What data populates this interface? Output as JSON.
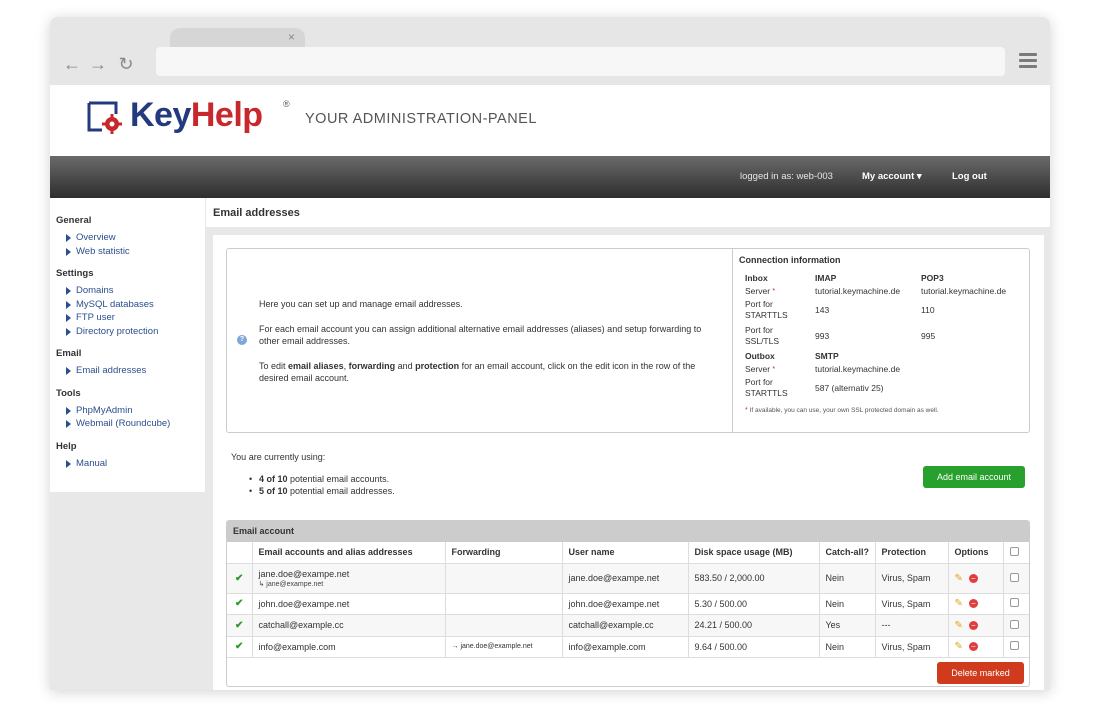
{
  "browser": {
    "tab_close": "×",
    "back_icon": "←",
    "forward_icon": "→",
    "reload_icon": "↻"
  },
  "header": {
    "logo_key": "Key",
    "logo_help": "Help",
    "logo_reg": "®",
    "tagline": "YOUR ADMINISTRATION-PANEL"
  },
  "topbar": {
    "logged_in": "logged in as: web-003",
    "my_account": "My account ▾",
    "logout": "Log out"
  },
  "sidebar": {
    "groups": [
      {
        "title": "General",
        "items": [
          "Overview",
          "Web statistic"
        ]
      },
      {
        "title": "Settings",
        "items": [
          "Domains",
          "MySQL databases",
          "FTP user",
          "Directory protection"
        ]
      },
      {
        "title": "Email",
        "items": [
          "Email addresses"
        ]
      },
      {
        "title": "Tools",
        "items": [
          "PhpMyAdmin",
          "Webmail (Roundcube)"
        ]
      },
      {
        "title": "Help",
        "items": [
          "Manual"
        ]
      }
    ]
  },
  "page": {
    "title": "Email addresses"
  },
  "info": {
    "p1": "Here you can set up and manage email addresses.",
    "p2": "For each email account you can assign additional alternative email addresses (aliases) and setup forwarding to other email addresses.",
    "p3_prefix": "To edit ",
    "p3_b1": "email aliases",
    "p3_sep1": ", ",
    "p3_b2": "forwarding",
    "p3_sep2": " and ",
    "p3_b3": "protection",
    "p3_suffix": " for an email account, click on the edit icon in the row of the desired email account."
  },
  "connection": {
    "title": "Connection information",
    "inbox": "Inbox",
    "imap": "IMAP",
    "pop3": "POP3",
    "server": "Server",
    "imap_server": "tutorial.keymachine.de",
    "pop3_server": "tutorial.keymachine.de",
    "port_starttls": "Port for STARTTLS",
    "imap_starttls": "143",
    "pop3_starttls": "110",
    "port_ssl": "Port for SSL/TLS",
    "imap_ssl": "993",
    "pop3_ssl": "995",
    "outbox": "Outbox",
    "smtp": "SMTP",
    "smtp_server": "tutorial.keymachine.de",
    "smtp_starttls": "587 (alternativ 25)",
    "asterisk": "*",
    "note": "If available, you can use, your own SSL protected domain as well."
  },
  "usage": {
    "intro": "You are currently using:",
    "accounts_bold": "4 of 10",
    "accounts_text": " potential email accounts.",
    "addresses_bold": "5 of 10",
    "addresses_text": " potential email addresses."
  },
  "add_button": "Add email account",
  "table": {
    "title": "Email account",
    "headers": [
      "Email accounts and alias addresses",
      "Forwarding",
      "User name",
      "Disk space usage (MB)",
      "Catch-all?",
      "Protection",
      "Options"
    ],
    "rows": [
      {
        "email": "jane.doe@exampe.net",
        "alias": "↳ jane@exampe.net",
        "forwarding": "",
        "user": "jane.doe@exampe.net",
        "disk": "583.50 / 2,000.00",
        "catchall": "Nein",
        "protection": "Virus, Spam"
      },
      {
        "email": "john.doe@exampe.net",
        "alias": "",
        "forwarding": "",
        "user": "john.doe@exampe.net",
        "disk": "5.30 / 500.00",
        "catchall": "Nein",
        "protection": "Virus, Spam"
      },
      {
        "email": "catchall@example.cc",
        "alias": "",
        "forwarding": "",
        "user": "catchall@example.cc",
        "disk": "24.21 / 500.00",
        "catchall": "Yes",
        "protection": "---"
      },
      {
        "email": "info@example.com",
        "alias": "",
        "forwarding": "→ jane.doe@example.net",
        "user": "info@example.com",
        "disk": "9.64 / 500.00",
        "catchall": "Nein",
        "protection": "Virus, Spam"
      }
    ],
    "check_glyph": "✔",
    "edit_glyph": "✎",
    "delete_glyph": "−"
  },
  "delete_button": "Delete marked",
  "colors": {
    "brand_blue": "#243a7e",
    "brand_red": "#c8282c",
    "add_green": "#27a02d",
    "delete_red": "#cf3b1c"
  }
}
